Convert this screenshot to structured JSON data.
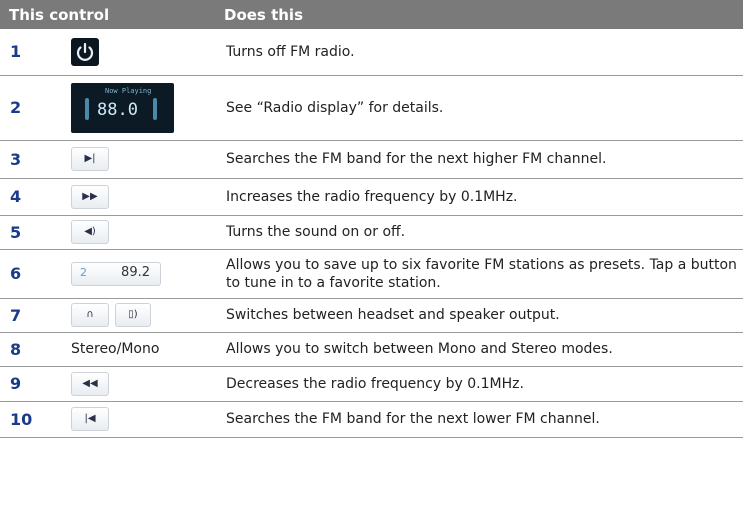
{
  "header": {
    "col1": "This control",
    "col2": "Does this"
  },
  "rows": [
    {
      "num": "1",
      "desc": "Turns off FM radio.",
      "icon": "power-icon"
    },
    {
      "num": "2",
      "desc": "See “Radio display” for details.",
      "icon": "radio-display",
      "display_title": "Now Playing",
      "display_freq": "88.0"
    },
    {
      "num": "3",
      "desc": "Searches the FM band for the next higher FM channel.",
      "icon": "next-channel-icon",
      "glyph": "▶|"
    },
    {
      "num": "4",
      "desc": "Increases the radio frequency by 0.1MHz.",
      "icon": "fast-forward-icon",
      "glyph": "▶▶"
    },
    {
      "num": "5",
      "desc": "Turns the sound on or off.",
      "icon": "speaker-icon",
      "glyph": "◀)"
    },
    {
      "num": "6",
      "desc": "Allows you to save up to six favorite FM stations as presets. Tap a button to tune in to a favorite station.",
      "icon": "preset-button",
      "preset_num": "2",
      "preset_val": "89.2"
    },
    {
      "num": "7",
      "desc": "Switches between headset and speaker output.",
      "icon": "headset-icon",
      "glyph": "∩",
      "glyph2": "▯)"
    },
    {
      "num": "8",
      "desc": "Allows you to switch between Mono and Stereo modes.",
      "control_text": "Stereo/Mono"
    },
    {
      "num": "9",
      "desc": "Decreases the radio frequency by 0.1MHz.",
      "icon": "rewind-icon",
      "glyph": "◀◀"
    },
    {
      "num": "10",
      "desc": "Searches the FM band for the next lower FM channel.",
      "icon": "previous-channel-icon",
      "glyph": "|◀"
    }
  ],
  "colors": {
    "header_bg": "#7a7a7a",
    "number_text": "#1a3a8a"
  }
}
